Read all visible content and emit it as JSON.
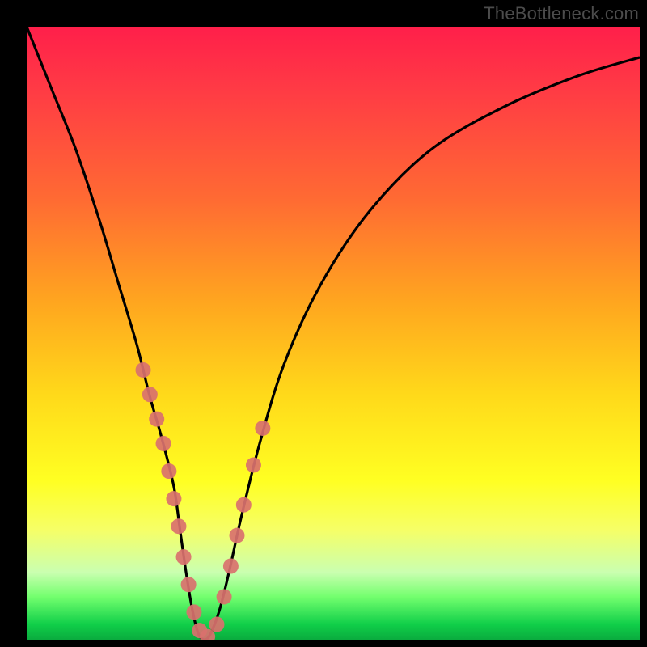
{
  "watermark": {
    "text": "TheBottleneck.com"
  },
  "chart_data": {
    "type": "line",
    "title": "",
    "xlabel": "",
    "ylabel": "",
    "xlim": [
      0,
      100
    ],
    "ylim": [
      0,
      100
    ],
    "grid": false,
    "legend_position": "none",
    "series": [
      {
        "name": "bottleneck-curve",
        "x": [
          0,
          4,
          8,
          12,
          15,
          18,
          20,
          22,
          24,
          25,
          26,
          27,
          28,
          29,
          30,
          31.5,
          33,
          35,
          38,
          42,
          48,
          56,
          66,
          78,
          90,
          100
        ],
        "values": [
          100,
          90,
          80,
          68,
          58,
          48,
          40,
          33,
          25,
          18,
          11,
          5,
          1,
          0,
          1,
          5,
          11,
          20,
          32,
          45,
          58,
          70,
          80,
          87,
          92,
          95
        ]
      }
    ],
    "markers": {
      "name": "highlight-points",
      "color": "#d9716e",
      "radius_approx": 10,
      "x": [
        19.0,
        20.1,
        21.2,
        22.3,
        23.2,
        24.0,
        24.8,
        25.6,
        26.4,
        27.3,
        28.2,
        29.5,
        31.0,
        32.2,
        33.3,
        34.3,
        35.4,
        37.0,
        38.5
      ],
      "values": [
        44.0,
        40.0,
        36.0,
        32.0,
        27.5,
        23.0,
        18.5,
        13.5,
        9.0,
        4.5,
        1.5,
        0.5,
        2.5,
        7.0,
        12.0,
        17.0,
        22.0,
        28.5,
        34.5
      ]
    },
    "background_gradient_stops": [
      {
        "pos": 0.0,
        "color": "#ff1f4a"
      },
      {
        "pos": 0.28,
        "color": "#ff6a33"
      },
      {
        "pos": 0.6,
        "color": "#ffd91a"
      },
      {
        "pos": 0.82,
        "color": "#f6ff66"
      },
      {
        "pos": 0.97,
        "color": "#10cf49"
      },
      {
        "pos": 1.0,
        "color": "#0aab3e"
      }
    ]
  }
}
